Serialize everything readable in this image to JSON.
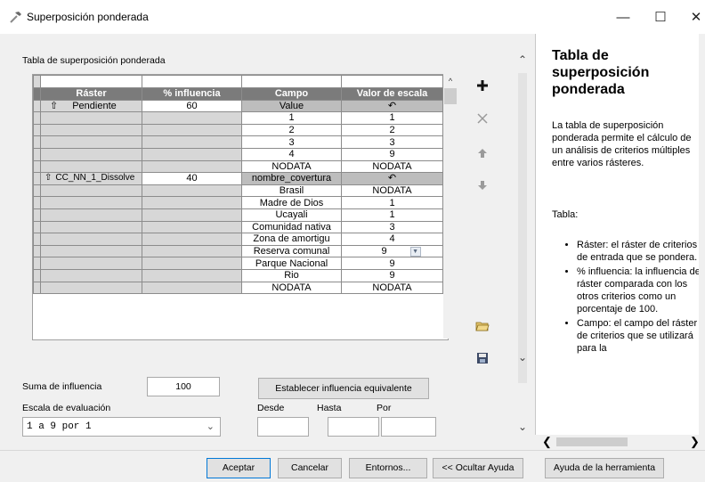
{
  "window": {
    "title": "Superposición ponderada",
    "minimize_glyph": "—",
    "maximize_glyph": "☐",
    "close_glyph": "✕"
  },
  "group_label": "Tabla de superposición ponderada",
  "table": {
    "headers": [
      "Ráster",
      "% influencia",
      "Campo",
      "Valor de escala"
    ],
    "raster1": {
      "name": "Pendiente",
      "influence": "60",
      "field": "Value"
    },
    "raster1_rows": [
      {
        "campo": "1",
        "valor": "1"
      },
      {
        "campo": "2",
        "valor": "2"
      },
      {
        "campo": "3",
        "valor": "3"
      },
      {
        "campo": "4",
        "valor": "9"
      },
      {
        "campo": "NODATA",
        "valor": "NODATA"
      }
    ],
    "raster2": {
      "name": "CC_NN_1_Dissolve",
      "influence": "40",
      "field": "nombre_covertura"
    },
    "raster2_rows": [
      {
        "campo": "Brasil",
        "valor": "NODATA"
      },
      {
        "campo": "Madre de Dios",
        "valor": "1"
      },
      {
        "campo": "Ucayali",
        "valor": "1"
      },
      {
        "campo": "Comunidad nativa",
        "valor": "3"
      },
      {
        "campo": "Zona de amortigu",
        "valor": "4"
      },
      {
        "campo": "Reserva comunal",
        "valor": "9"
      },
      {
        "campo": "Parque Nacional",
        "valor": "9"
      },
      {
        "campo": "Rio",
        "valor": "9"
      },
      {
        "campo": "NODATA",
        "valor": "NODATA"
      }
    ]
  },
  "sum_label": "Suma de influencia",
  "sum_value": "100",
  "equal_button": "Establecer influencia equivalente",
  "scale_label": "Escala de evaluación",
  "scale_value": "1 a 9 por 1",
  "from_label": "Desde",
  "to_label": "Hasta",
  "by_label": "Por",
  "help": {
    "title": "Tabla de superposición ponderada",
    "paragraph": "La tabla de superposición ponderada permite el cálculo de un análisis de criterios múltiples entre varios rásteres.",
    "tabla_label": "Tabla:",
    "items": [
      "Ráster: el ráster de criterios de entrada que se pondera.",
      "% influencia: la influencia del ráster comparada con los otros criterios como un porcentaje de 100.",
      "Campo: el campo del ráster de criterios que se utilizará para la"
    ]
  },
  "footer": {
    "ok": "Aceptar",
    "cancel": "Cancelar",
    "env": "Entornos...",
    "hide_help": "<< Ocultar Ayuda",
    "tool_help": "Ayuda de la herramienta"
  },
  "icons": {
    "add": "plus-icon",
    "remove": "x-icon",
    "up": "arrow-up-icon",
    "down": "arrow-down-icon",
    "open": "folder-open-icon",
    "save": "floppy-disk-icon"
  }
}
